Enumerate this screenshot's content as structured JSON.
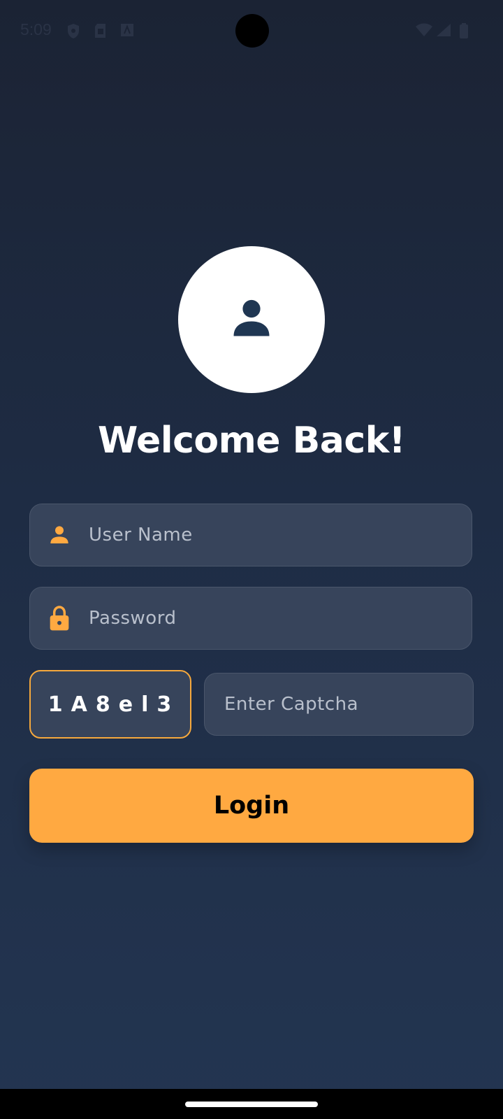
{
  "status_bar": {
    "time": "5:09",
    "left_icons": [
      "shield-icon",
      "sim-card-icon",
      "font-icon"
    ],
    "right_icons": [
      "wifi-icon",
      "signal-icon",
      "battery-icon"
    ]
  },
  "avatar": {
    "icon": "person-icon"
  },
  "title": "Welcome Back!",
  "username": {
    "icon": "person-icon",
    "placeholder": "User Name",
    "value": ""
  },
  "password": {
    "icon": "lock-icon",
    "placeholder": "Password",
    "value": ""
  },
  "captcha": {
    "code": "1A8el3",
    "placeholder": "Enter Captcha",
    "value": ""
  },
  "login_label": "Login",
  "colors": {
    "accent": "#ffa941",
    "background_top": "#1b2334",
    "background_bottom": "#233551",
    "field": "#37445b",
    "avatar_icon": "#1f3652"
  }
}
